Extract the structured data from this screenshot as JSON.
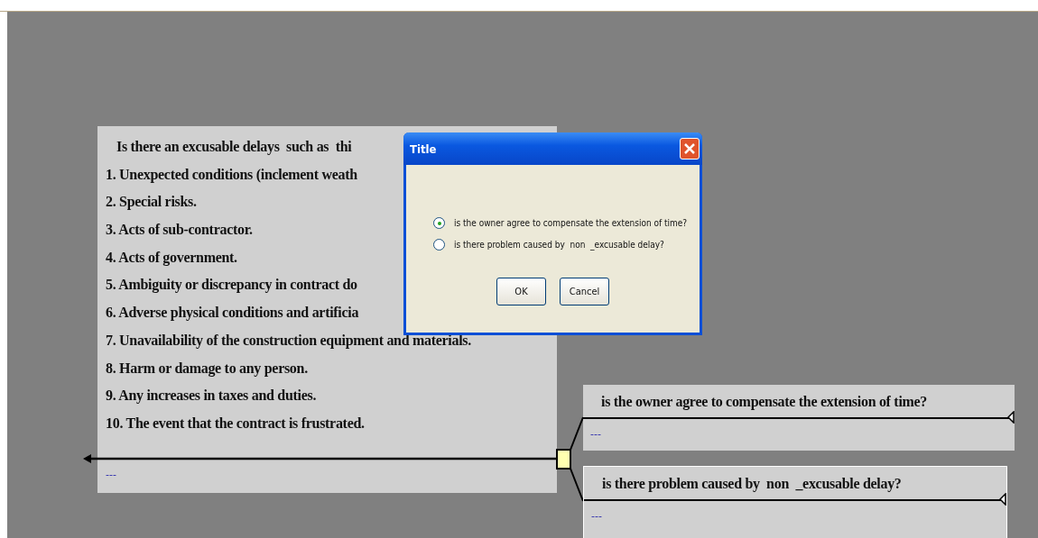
{
  "decision_node": {
    "lines": [
      "Is there an excusable delays  such as  thi",
      "1. Unexpected conditions (inclement weath",
      "2. Special risks.",
      "3. Acts of sub-contractor.",
      "4. Acts of government.",
      "5. Ambiguity or discrepancy in contract do",
      "6. Adverse physical conditions and artificia",
      "7. Unavailability of the construction equipment and materials.",
      "8. Harm or damage to any person.",
      "9. Any increases in taxes and duties.",
      "10. The event that the contract is frustrated."
    ],
    "note": "---"
  },
  "branches": [
    {
      "title": "is the owner agree to compensate the extension of time?",
      "note": "---",
      "selected": false
    },
    {
      "title": "is there problem caused by  non  _excusable delay?",
      "note": "---",
      "selected": true
    }
  ],
  "dialog": {
    "title": "Title",
    "options": [
      {
        "label": "is the owner agree to compensate the extension of time?",
        "selected": true
      },
      {
        "label": "is there problem caused by  non  _excusable delay?",
        "selected": false
      }
    ],
    "buttons": [
      "OK",
      "Cancel"
    ]
  }
}
